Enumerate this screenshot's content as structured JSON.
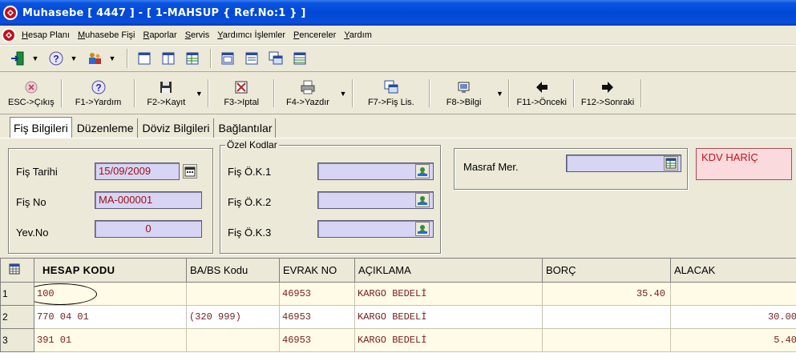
{
  "window": {
    "title": "Muhasebe [ 4447 ]  - [ 1-MAHSUP { Ref.No:1 } ]"
  },
  "menu": [
    {
      "ul": "H",
      "rest": "esap Planı"
    },
    {
      "ul": "M",
      "rest": "uhasebe Fişi"
    },
    {
      "ul": "R",
      "rest": "aporlar"
    },
    {
      "ul": "S",
      "rest": "ervis"
    },
    {
      "ul": "Y",
      "rest": "ardımcı İşlemler"
    },
    {
      "ul": "P",
      "rest": "encereler"
    },
    {
      "ul": "Y",
      "rest": "ardım"
    }
  ],
  "toolbar2": {
    "esc": "ESC->Çıkış",
    "f1": "F1->Yardım",
    "f2": "F2->Kayıt",
    "f3": "F3->Iptal",
    "f4": "F4->Yazdır",
    "f7": "F7->Fiş Lis.",
    "f8": "F8->Bilgi",
    "f11": "F11->Önceki",
    "f12": "F12->Sonraki"
  },
  "tabs": [
    "Fiş Bilgileri",
    "Düzenleme",
    "Döviz Bilgileri",
    "Bağlantılar"
  ],
  "form": {
    "fis_tarihi_label": "Fiş Tarihi",
    "fis_tarihi": "15/09/2009",
    "fis_no_label": "Fiş No",
    "fis_no": "MA-000001",
    "yev_no_label": "Yev.No",
    "yev_no": "0",
    "ozel_kodlar": "Özel Kodlar",
    "ok1": "Fiş Ö.K.1",
    "ok2": "Fiş Ö.K.2",
    "ok3": "Fiş Ö.K.3",
    "masraf_label": "Masraf Mer.",
    "kdv": "KDV HARİÇ"
  },
  "grid": {
    "headers": [
      "HESAP KODU",
      "BA/BS Kodu",
      "EVRAK NO",
      "AÇIKLAMA",
      "BORÇ",
      "ALACAK"
    ],
    "rows": [
      {
        "n": "1",
        "hesap": "100",
        "babs": "",
        "evrak": "46953",
        "aciklama": "KARGO BEDELİ",
        "borc": "35.40",
        "alacak": ""
      },
      {
        "n": "2",
        "hesap": "770 04 01",
        "babs": "(320 999)",
        "evrak": "46953",
        "aciklama": "KARGO BEDELİ",
        "borc": "",
        "alacak": "30.00"
      },
      {
        "n": "3",
        "hesap": "391 01",
        "babs": "",
        "evrak": "46953",
        "aciklama": "KARGO BEDELİ",
        "borc": "",
        "alacak": "5.40"
      }
    ]
  }
}
